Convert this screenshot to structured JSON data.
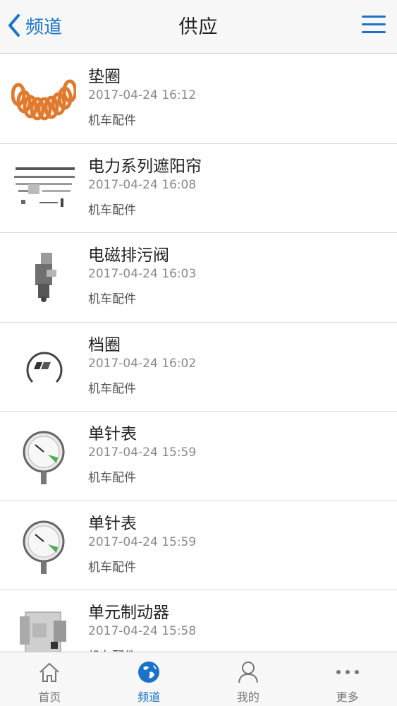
{
  "header": {
    "back_label": "频道",
    "title": "供应"
  },
  "items": [
    {
      "title": "垫圈",
      "date": "2017-04-24 16:12",
      "category": "机车配件",
      "thumb": "washer-rings-image"
    },
    {
      "title": "电力系列遮阳帘",
      "date": "2017-04-24 16:08",
      "category": "机车配件",
      "thumb": "sunshade-rods-image"
    },
    {
      "title": "电磁排污阀",
      "date": "2017-04-24 16:03",
      "category": "机车配件",
      "thumb": "solenoid-valve-image"
    },
    {
      "title": "档圈",
      "date": "2017-04-24 16:02",
      "category": "机车配件",
      "thumb": "retaining-ring-image"
    },
    {
      "title": "单针表",
      "date": "2017-04-24 15:59",
      "category": "机车配件",
      "thumb": "pressure-gauge-image"
    },
    {
      "title": "单针表",
      "date": "2017-04-24 15:59",
      "category": "机车配件",
      "thumb": "pressure-gauge-image"
    },
    {
      "title": "单元制动器",
      "date": "2017-04-24 15:58",
      "category": "机车配件",
      "thumb": "brake-unit-image"
    }
  ],
  "tabs": [
    {
      "label": "首页",
      "icon": "home-icon",
      "active": false
    },
    {
      "label": "频道",
      "icon": "globe-icon",
      "active": true
    },
    {
      "label": "我的",
      "icon": "user-icon",
      "active": false
    },
    {
      "label": "更多",
      "icon": "more-icon",
      "active": false
    }
  ],
  "colors": {
    "accent": "#1a73c9",
    "washer": "#e07a2e"
  }
}
